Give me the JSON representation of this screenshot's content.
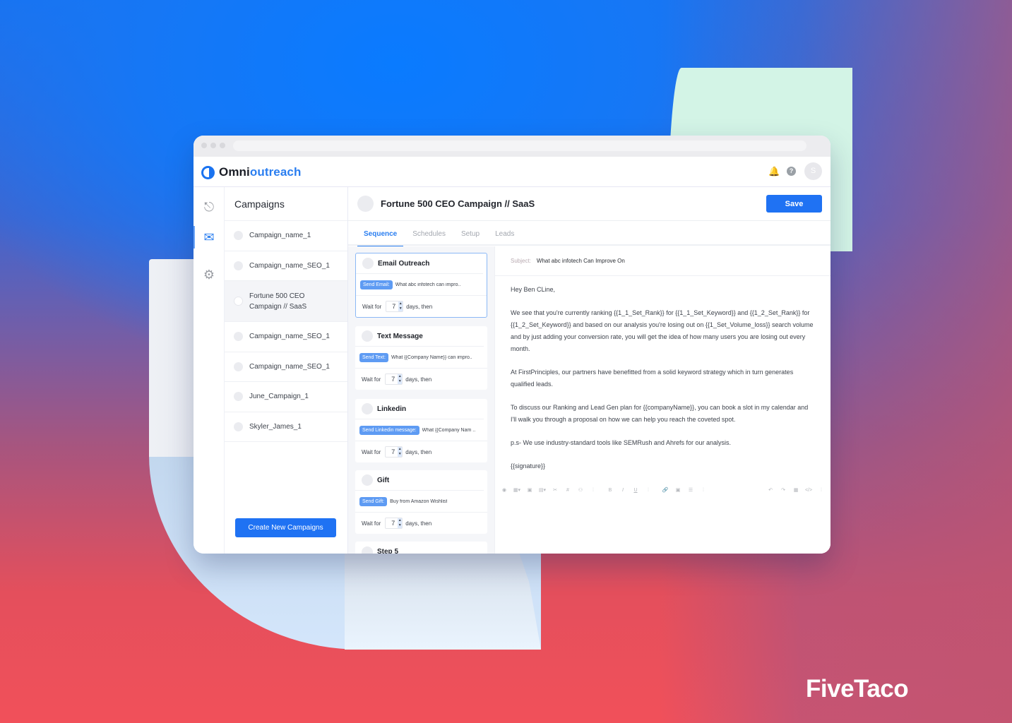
{
  "app": {
    "logo_primary": "Omni",
    "logo_secondary": "outreach",
    "avatar_initial": "S",
    "accent_color": "#1f72f3"
  },
  "rail": [
    {
      "icon": "inbox-tray-icon",
      "active": false
    },
    {
      "icon": "mail-campaign-icon",
      "active": true
    },
    {
      "icon": "gear-icon",
      "active": false
    }
  ],
  "campaigns": {
    "heading": "Campaigns",
    "items": [
      {
        "label": "Campaign_name_1",
        "selected": false
      },
      {
        "label": "Campaign_name_SEO_1",
        "selected": false
      },
      {
        "label": "Fortune 500 CEO Campaign // SaaS",
        "selected": true
      },
      {
        "label": "Campaign_name_SEO_1",
        "selected": false
      },
      {
        "label": "Campaign_name_SEO_1",
        "selected": false
      },
      {
        "label": "June_Campaign_1",
        "selected": false
      },
      {
        "label": "Skyler_James_1",
        "selected": false
      }
    ],
    "create_button": "Create New Campaigns"
  },
  "main": {
    "title": "Fortune 500 CEO Campaign // SaaS",
    "save_label": "Save",
    "tabs": [
      {
        "label": "Sequence",
        "active": true
      },
      {
        "label": "Schedules",
        "active": false
      },
      {
        "label": "Setup",
        "active": false
      },
      {
        "label": "Leads",
        "active": false
      }
    ]
  },
  "sequence": {
    "steps": [
      {
        "title": "Email Outreach",
        "badge": "Send Email:",
        "preview": "What abc infotech can impro..",
        "wait_label": "Wait for",
        "wait_value": "7",
        "wait_suffix": "days, then",
        "selected": true
      },
      {
        "title": "Text Message",
        "badge": "Send Text:",
        "preview": "What {{Company Name}} can impro..",
        "wait_label": "Wait for",
        "wait_value": "7",
        "wait_suffix": "days, then",
        "selected": false
      },
      {
        "title": "Linkedin",
        "badge": "Send Linkedin message:",
        "preview": "What {{Company Nam ..",
        "wait_label": "Wait for",
        "wait_value": "7",
        "wait_suffix": "days, then",
        "selected": false
      },
      {
        "title": "Gift",
        "badge": "Send Gift:",
        "preview": "Buy from Amazon Wishlist",
        "wait_label": "Wait for",
        "wait_value": "7",
        "wait_suffix": "days, then",
        "selected": false
      },
      {
        "title": "Step 5"
      }
    ]
  },
  "editor": {
    "subject_label": "Subject:",
    "subject": "What abc infotech Can Improve On",
    "paragraphs": [
      "Hey Ben CLine,",
      "We see that you're currently ranking {{1_1_Set_Rank}} for {{1_1_Set_Keyword}} and {{1_2_Set_Rank}} for {{1_2_Set_Keyword}} and based on our analysis you're losing out on {{1_Set_Volume_loss}} search volume and by just adding your conversion rate, you will get the idea of how many users you are losing out every month.",
      "At FirstPrinciples, our partners have benefitted from a solid keyword strategy which in turn generates qualified leads.",
      "To discuss our Ranking and Lead Gen plan for {{companyName}}, you can book a slot in my calendar and I'll walk you through a proposal on how we can help you reach the coveted spot.",
      "p.s- We use industry-standard tools like SEMRush and Ahrefs for our analysis.",
      "{{signature}}"
    ],
    "toolbar": {
      "preview": "◉",
      "table": "▦▾",
      "image": "▣",
      "template": "▤▾",
      "cut": "✂",
      "hash": "#",
      "person": "⚇",
      "bold": "B",
      "italic": "I",
      "underline": "U",
      "link": "🔗",
      "media": "▣",
      "list": "☰",
      "undo": "↶",
      "redo": "↷",
      "grid": "▦",
      "code": "</>",
      "sep": "⁞"
    }
  },
  "brand": {
    "name": "FiveTaco"
  }
}
